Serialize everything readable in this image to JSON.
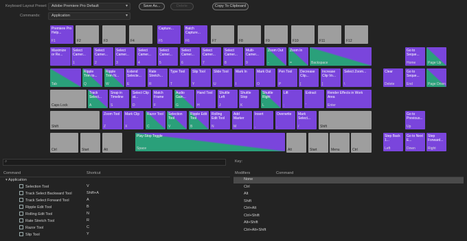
{
  "top": {
    "preset_label": "Keyboard Layout Preset:",
    "preset_value": "Adobe Premiere Pro Default",
    "commands_label": "Commands:",
    "commands_value": "Application",
    "save_as": "Save As...",
    "delete": "Delete",
    "copy": "Copy To Clipboard"
  },
  "keys": [
    {
      "k": "F1",
      "c": "Premiere Pro Help...",
      "s": "p"
    },
    {
      "k": "F2",
      "c": "",
      "s": "g"
    },
    {
      "k": "F3",
      "c": "",
      "s": "g"
    },
    {
      "k": "F4",
      "c": "",
      "s": "g"
    },
    {
      "k": "F5",
      "c": "Capture...",
      "s": "p"
    },
    {
      "k": "F6",
      "c": "Batch Capture...",
      "s": "p"
    },
    {
      "k": "F7",
      "c": "",
      "s": "g"
    },
    {
      "k": "F8",
      "c": "",
      "s": "g"
    },
    {
      "k": "F9",
      "c": "",
      "s": "g"
    },
    {
      "k": "F10",
      "c": "",
      "s": "g"
    },
    {
      "k": "F11",
      "c": "",
      "s": "g"
    },
    {
      "k": "F12",
      "c": "",
      "s": "g"
    },
    {
      "k": "",
      "c": "Maximize or Re...",
      "s": "p"
    },
    {
      "k": "1",
      "c": "Select Camer...",
      "s": "p"
    },
    {
      "k": "2",
      "c": "Select Camer...",
      "s": "p"
    },
    {
      "k": "3",
      "c": "Select Camer...",
      "s": "p"
    },
    {
      "k": "4",
      "c": "Select Camer...",
      "s": "p"
    },
    {
      "k": "5",
      "c": "Select Camer...",
      "s": "p"
    },
    {
      "k": "6",
      "c": "Select Camer...",
      "s": "p"
    },
    {
      "k": "7",
      "c": "Select Camer...",
      "s": "p"
    },
    {
      "k": "8",
      "c": "Select Camer...",
      "s": "p"
    },
    {
      "k": "9",
      "c": "Multi-Camer...",
      "s": "p"
    },
    {
      "k": "-",
      "c": "Zoom Out",
      "s": "pt"
    },
    {
      "k": "=",
      "c": "Zoom In",
      "s": "pt"
    },
    {
      "k": "Backspace",
      "c": "",
      "s": "pt"
    },
    {
      "k": "Tab",
      "c": "",
      "s": "pt"
    },
    {
      "k": "Q",
      "c": "Ripple Trim to...",
      "s": "pt"
    },
    {
      "k": "W",
      "c": "Ripple Trim N...",
      "s": "pt"
    },
    {
      "k": "E",
      "c": "Extend Selecte...",
      "s": "p"
    },
    {
      "k": "R",
      "c": "Rate Stretch...",
      "s": "p"
    },
    {
      "k": "T",
      "c": "Type Tool",
      "s": "p"
    },
    {
      "k": "Y",
      "c": "Slip Tool",
      "s": "p"
    },
    {
      "k": "U",
      "c": "Slide Tool",
      "s": "p"
    },
    {
      "k": "I",
      "c": "Mark In",
      "s": "p"
    },
    {
      "k": "O",
      "c": "Mark Out",
      "s": "p"
    },
    {
      "k": "P",
      "c": "Pen Tool",
      "s": "p"
    },
    {
      "k": "[",
      "c": "Decrease Clip...",
      "s": "p"
    },
    {
      "k": "]",
      "c": "Increase Clip Vo...",
      "s": "p"
    },
    {
      "k": "\\",
      "c": "Select Zoom...",
      "s": "p"
    },
    {
      "k": "Caps Lock",
      "c": "",
      "s": "g"
    },
    {
      "k": "A",
      "c": "Track Select...",
      "s": "pt"
    },
    {
      "k": "S",
      "c": "Snap in Timeline",
      "s": "p"
    },
    {
      "k": "D",
      "c": "Select Clip at...",
      "s": "p"
    },
    {
      "k": "F",
      "c": "Match Frame",
      "s": "p"
    },
    {
      "k": "G",
      "c": "Audio Gain...",
      "s": "pt"
    },
    {
      "k": "H",
      "c": "Hand Tool",
      "s": "p"
    },
    {
      "k": "J",
      "c": "Shuttle Left",
      "s": "p"
    },
    {
      "k": "K",
      "c": "Shuttle Stop",
      "s": "p"
    },
    {
      "k": "L",
      "c": "Shuttle Right",
      "s": "pt"
    },
    {
      "k": ";",
      "c": "Lift",
      "s": "p"
    },
    {
      "k": "'",
      "c": "Extract",
      "s": "p"
    },
    {
      "k": "Enter",
      "c": "Render Effects in Work Area",
      "s": "p"
    },
    {
      "k": "Shift",
      "c": "",
      "s": "g"
    },
    {
      "k": "Z",
      "c": "Zoom Tool",
      "s": "p"
    },
    {
      "k": "X",
      "c": "Mark Clip",
      "s": "p"
    },
    {
      "k": "C",
      "c": "Razor Tool",
      "s": "pt"
    },
    {
      "k": "V",
      "c": "Selection Tool",
      "s": "pt"
    },
    {
      "k": "B",
      "c": "Ripple Edit Tool",
      "s": "pt"
    },
    {
      "k": "N",
      "c": "Rolling Edit Tool",
      "s": "p"
    },
    {
      "k": "M",
      "c": "Add Marker",
      "s": "p"
    },
    {
      "k": ",",
      "c": "Insert",
      "s": "p"
    },
    {
      "k": ".",
      "c": "Overwrite",
      "s": "p"
    },
    {
      "k": "/",
      "c": "Mark Select...",
      "s": "p"
    },
    {
      "k": "Shift",
      "c": "",
      "s": "g"
    },
    {
      "k": "Ctrl",
      "c": "",
      "s": "g"
    },
    {
      "k": "Start",
      "c": "",
      "s": "g"
    },
    {
      "k": "Alt",
      "c": "",
      "s": "g"
    },
    {
      "k": "Space",
      "c": "Play-Stop Toggle",
      "s": "pt"
    },
    {
      "k": "Alt",
      "c": "",
      "s": "g"
    },
    {
      "k": "Start",
      "c": "",
      "s": "g"
    },
    {
      "k": "Menu",
      "c": "",
      "s": "g"
    },
    {
      "k": "Ctrl",
      "c": "",
      "s": "g"
    },
    {
      "k": "Delete",
      "c": "Clear",
      "s": "p"
    },
    {
      "k": "Home",
      "c": "Go to Seque...",
      "s": "p"
    },
    {
      "k": "Page Up",
      "c": "",
      "s": "pt"
    },
    {
      "k": "End",
      "c": "Go to Seque...",
      "s": "p"
    },
    {
      "k": "Page Down",
      "c": "",
      "s": "pt"
    },
    {
      "k": "Up",
      "c": "Go to Previous...",
      "s": "p"
    },
    {
      "k": "Left",
      "c": "Step Back 1...",
      "s": "p"
    },
    {
      "k": "Down",
      "c": "Go to Next E...",
      "s": "p"
    },
    {
      "k": "Right",
      "c": "Step Forward...",
      "s": "p"
    }
  ],
  "cmd_panel": {
    "search_placeholder": "",
    "col_command": "Command",
    "col_shortcut": "Shortcut",
    "group": "Application",
    "rows": [
      {
        "name": "Selection Tool",
        "key": "V"
      },
      {
        "name": "Track Select Backward Tool",
        "key": "Shift+A"
      },
      {
        "name": "Track Select Forward Tool",
        "key": "A"
      },
      {
        "name": "Ripple Edit Tool",
        "key": "B"
      },
      {
        "name": "Rolling Edit Tool",
        "key": "N"
      },
      {
        "name": "Rate Stretch Tool",
        "key": "R"
      },
      {
        "name": "Razor Tool",
        "key": "C"
      },
      {
        "name": "Slip Tool",
        "key": "Y"
      }
    ]
  },
  "key_panel": {
    "title": "Key:",
    "col_modifiers": "Modifiers",
    "col_command": "Command",
    "rows": [
      "None",
      "Ctrl",
      "Alt",
      "Shift",
      "Ctrl+Alt",
      "Ctrl+Shift",
      "Alt+Shift",
      "Ctrl+Alt+Shift"
    ]
  },
  "colors": {
    "app_accent": "#7a45dc",
    "panel_accent": "#2aa07a"
  }
}
